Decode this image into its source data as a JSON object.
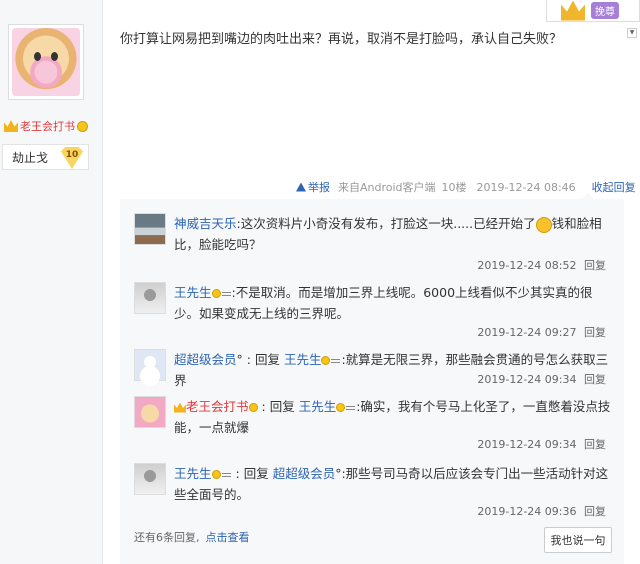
{
  "author": {
    "name": "老王会打书",
    "level_name": "劫止戈",
    "level_number": "10"
  },
  "top_badge": {
    "label": "挽尊"
  },
  "post": {
    "content": "你打算让网易把到嘴边的肉吐出来？再说，取消不是打脸吗，承认自己失败？",
    "report": "举报",
    "source": "来自Android客户端",
    "floor": "10楼",
    "time": "2019-12-24 08:46",
    "collapse": "收起回复"
  },
  "replies": [
    {
      "user": "神威吉天乐",
      "text_before": ":这次资料片小奇没有发布，打脸这一块.....已经开始了",
      "text_after": "钱和脸相比，脸能吃吗？",
      "time": "2019-12-24 08:52",
      "reply_label": "回复"
    },
    {
      "user": "王先生",
      "text": ":不是取消。而是增加三界上线呢。6000上线看似不少其实真的很少。如果变成无上线的三界呢。",
      "time": "2019-12-24 09:27",
      "reply_label": "回复"
    },
    {
      "user": "超超级会员",
      "suffix": "°",
      "reply_word": "回复",
      "target": "王先生",
      "text": ":就算是无限三界，那些融会贯通的号怎么获取三界",
      "time": "2019-12-24 09:34",
      "reply_label": "回复"
    },
    {
      "user": "老王会打书",
      "reply_word": "回复",
      "target": "王先生",
      "text": ":确实，我有个号马上化圣了，一直憋着没点技能，一点就爆",
      "time": "2019-12-24 09:34",
      "reply_label": "回复"
    },
    {
      "user": "王先生",
      "reply_word": "回复",
      "target": "超超级会员",
      "target_suffix": "°",
      "text": ":那些号司马奇以后应该会专门出一些活动针对这些全面号的。",
      "time": "2019-12-24 09:36",
      "reply_label": "回复"
    }
  ],
  "footer": {
    "more_text": "还有6条回复,",
    "more_link": "点击查看",
    "say_button": "我也说一句"
  }
}
